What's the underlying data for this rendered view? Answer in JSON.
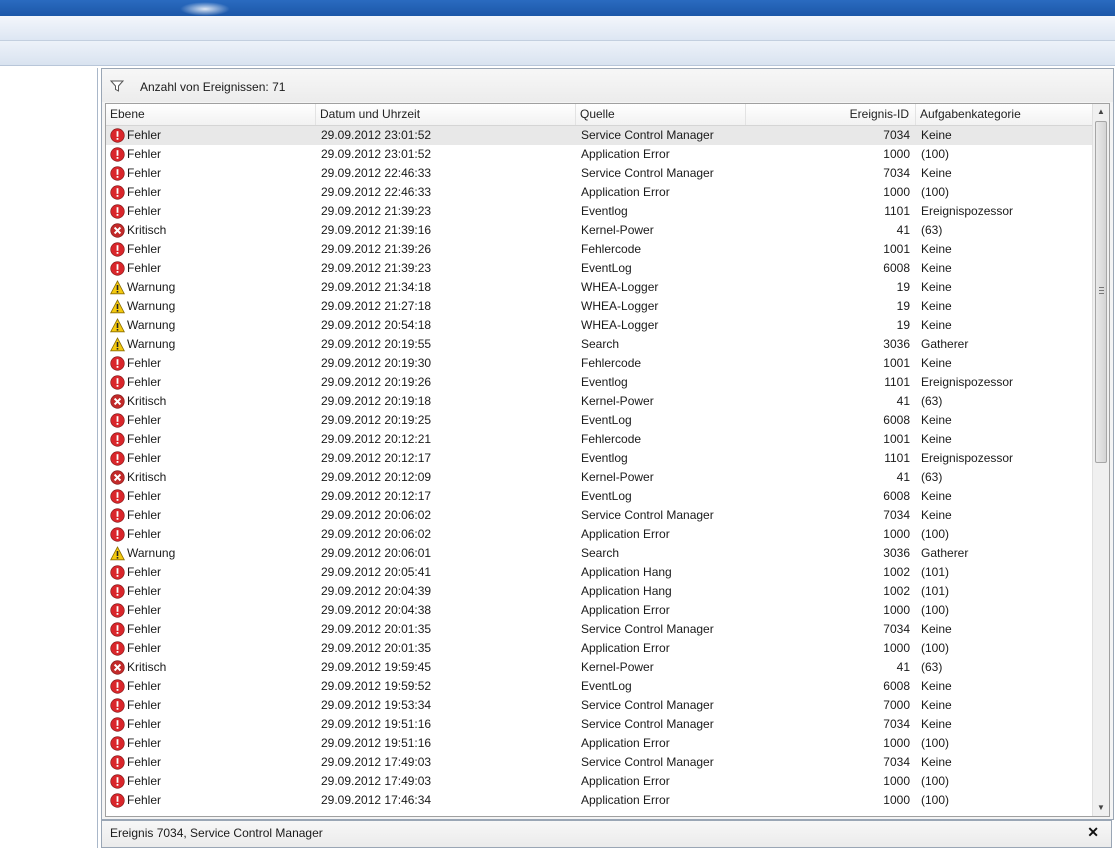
{
  "summary": {
    "event_count_label": "Anzahl von Ereignissen: 71"
  },
  "columns": {
    "level": "Ebene",
    "date": "Datum und Uhrzeit",
    "source": "Quelle",
    "event_id": "Ereignis-ID",
    "task": "Aufgabenkategorie"
  },
  "icons": {
    "error": "error-icon",
    "critical": "critical-icon",
    "warning": "warning-icon"
  },
  "colors": {
    "error": "#d9262b",
    "critical": "#c22a2a",
    "warning": "#f4c90f",
    "selected_row": "#e8e8e8"
  },
  "rows": [
    {
      "level": "Fehler",
      "type": "error",
      "date": "29.09.2012 23:01:52",
      "source": "Service Control Manager",
      "id": "7034",
      "task": "Keine"
    },
    {
      "level": "Fehler",
      "type": "error",
      "date": "29.09.2012 23:01:52",
      "source": "Application Error",
      "id": "1000",
      "task": "(100)"
    },
    {
      "level": "Fehler",
      "type": "error",
      "date": "29.09.2012 22:46:33",
      "source": "Service Control Manager",
      "id": "7034",
      "task": "Keine"
    },
    {
      "level": "Fehler",
      "type": "error",
      "date": "29.09.2012 22:46:33",
      "source": "Application Error",
      "id": "1000",
      "task": "(100)"
    },
    {
      "level": "Fehler",
      "type": "error",
      "date": "29.09.2012 21:39:23",
      "source": "Eventlog",
      "id": "1101",
      "task": "Ereignispozessor"
    },
    {
      "level": "Kritisch",
      "type": "critical",
      "date": "29.09.2012 21:39:16",
      "source": "Kernel-Power",
      "id": "41",
      "task": "(63)"
    },
    {
      "level": "Fehler",
      "type": "error",
      "date": "29.09.2012 21:39:26",
      "source": "Fehlercode",
      "id": "1001",
      "task": "Keine"
    },
    {
      "level": "Fehler",
      "type": "error",
      "date": "29.09.2012 21:39:23",
      "source": "EventLog",
      "id": "6008",
      "task": "Keine"
    },
    {
      "level": "Warnung",
      "type": "warning",
      "date": "29.09.2012 21:34:18",
      "source": "WHEA-Logger",
      "id": "19",
      "task": "Keine"
    },
    {
      "level": "Warnung",
      "type": "warning",
      "date": "29.09.2012 21:27:18",
      "source": "WHEA-Logger",
      "id": "19",
      "task": "Keine"
    },
    {
      "level": "Warnung",
      "type": "warning",
      "date": "29.09.2012 20:54:18",
      "source": "WHEA-Logger",
      "id": "19",
      "task": "Keine"
    },
    {
      "level": "Warnung",
      "type": "warning",
      "date": "29.09.2012 20:19:55",
      "source": "Search",
      "id": "3036",
      "task": "Gatherer"
    },
    {
      "level": "Fehler",
      "type": "error",
      "date": "29.09.2012 20:19:30",
      "source": "Fehlercode",
      "id": "1001",
      "task": "Keine"
    },
    {
      "level": "Fehler",
      "type": "error",
      "date": "29.09.2012 20:19:26",
      "source": "Eventlog",
      "id": "1101",
      "task": "Ereignispozessor"
    },
    {
      "level": "Kritisch",
      "type": "critical",
      "date": "29.09.2012 20:19:18",
      "source": "Kernel-Power",
      "id": "41",
      "task": "(63)"
    },
    {
      "level": "Fehler",
      "type": "error",
      "date": "29.09.2012 20:19:25",
      "source": "EventLog",
      "id": "6008",
      "task": "Keine"
    },
    {
      "level": "Fehler",
      "type": "error",
      "date": "29.09.2012 20:12:21",
      "source": "Fehlercode",
      "id": "1001",
      "task": "Keine"
    },
    {
      "level": "Fehler",
      "type": "error",
      "date": "29.09.2012 20:12:17",
      "source": "Eventlog",
      "id": "1101",
      "task": "Ereignispozessor"
    },
    {
      "level": "Kritisch",
      "type": "critical",
      "date": "29.09.2012 20:12:09",
      "source": "Kernel-Power",
      "id": "41",
      "task": "(63)"
    },
    {
      "level": "Fehler",
      "type": "error",
      "date": "29.09.2012 20:12:17",
      "source": "EventLog",
      "id": "6008",
      "task": "Keine"
    },
    {
      "level": "Fehler",
      "type": "error",
      "date": "29.09.2012 20:06:02",
      "source": "Service Control Manager",
      "id": "7034",
      "task": "Keine"
    },
    {
      "level": "Fehler",
      "type": "error",
      "date": "29.09.2012 20:06:02",
      "source": "Application Error",
      "id": "1000",
      "task": "(100)"
    },
    {
      "level": "Warnung",
      "type": "warning",
      "date": "29.09.2012 20:06:01",
      "source": "Search",
      "id": "3036",
      "task": "Gatherer"
    },
    {
      "level": "Fehler",
      "type": "error",
      "date": "29.09.2012 20:05:41",
      "source": "Application Hang",
      "id": "1002",
      "task": "(101)"
    },
    {
      "level": "Fehler",
      "type": "error",
      "date": "29.09.2012 20:04:39",
      "source": "Application Hang",
      "id": "1002",
      "task": "(101)"
    },
    {
      "level": "Fehler",
      "type": "error",
      "date": "29.09.2012 20:04:38",
      "source": "Application Error",
      "id": "1000",
      "task": "(100)"
    },
    {
      "level": "Fehler",
      "type": "error",
      "date": "29.09.2012 20:01:35",
      "source": "Service Control Manager",
      "id": "7034",
      "task": "Keine"
    },
    {
      "level": "Fehler",
      "type": "error",
      "date": "29.09.2012 20:01:35",
      "source": "Application Error",
      "id": "1000",
      "task": "(100)"
    },
    {
      "level": "Kritisch",
      "type": "critical",
      "date": "29.09.2012 19:59:45",
      "source": "Kernel-Power",
      "id": "41",
      "task": "(63)"
    },
    {
      "level": "Fehler",
      "type": "error",
      "date": "29.09.2012 19:59:52",
      "source": "EventLog",
      "id": "6008",
      "task": "Keine"
    },
    {
      "level": "Fehler",
      "type": "error",
      "date": "29.09.2012 19:53:34",
      "source": "Service Control Manager",
      "id": "7000",
      "task": "Keine"
    },
    {
      "level": "Fehler",
      "type": "error",
      "date": "29.09.2012 19:51:16",
      "source": "Service Control Manager",
      "id": "7034",
      "task": "Keine"
    },
    {
      "level": "Fehler",
      "type": "error",
      "date": "29.09.2012 19:51:16",
      "source": "Application Error",
      "id": "1000",
      "task": "(100)"
    },
    {
      "level": "Fehler",
      "type": "error",
      "date": "29.09.2012 17:49:03",
      "source": "Service Control Manager",
      "id": "7034",
      "task": "Keine"
    },
    {
      "level": "Fehler",
      "type": "error",
      "date": "29.09.2012 17:49:03",
      "source": "Application Error",
      "id": "1000",
      "task": "(100)"
    },
    {
      "level": "Fehler",
      "type": "error",
      "date": "29.09.2012 17:46:34",
      "source": "Application Error",
      "id": "1000",
      "task": "(100)"
    }
  ],
  "detail": {
    "title": "Ereignis 7034, Service Control Manager",
    "close_glyph": "✕"
  },
  "scrollbar": {
    "up_glyph": "▲",
    "down_glyph": "▼"
  }
}
